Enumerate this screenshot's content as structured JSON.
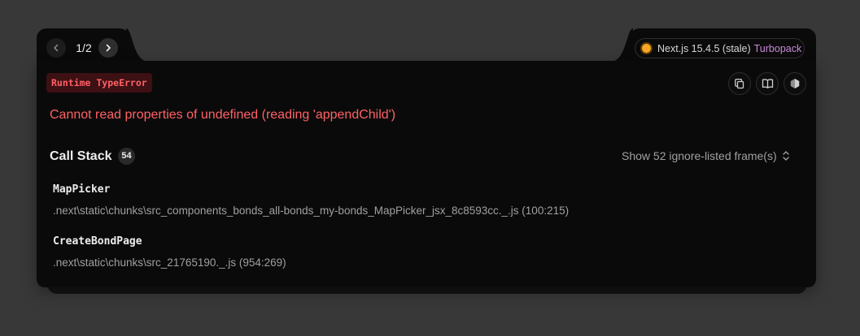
{
  "pager": {
    "current_label": "1/2",
    "prev_icon": "chevron-left-icon",
    "next_icon": "chevron-right-icon"
  },
  "version": {
    "label": "Next.js 15.4.5 (stale)",
    "bundler": "Turbopack",
    "status_color": "#f5a623"
  },
  "error": {
    "type": "Runtime TypeError",
    "message": "Cannot read properties of undefined (reading 'appendChild')"
  },
  "toolbar": {
    "icons": [
      "copy-icon",
      "docs-book-icon",
      "nextjs-logo-icon"
    ]
  },
  "callstack": {
    "title": "Call Stack",
    "count": "54",
    "ignore_toggle_label": "Show 52 ignore-listed frame(s)",
    "frames": [
      {
        "name": "MapPicker",
        "path": ".next\\static\\chunks\\src_components_bonds_all-bonds_my-bonds_MapPicker_jsx_8c8593cc._.js (100:215)"
      },
      {
        "name": "CreateBondPage",
        "path": ".next\\static\\chunks\\src_21765190._.js (954:269)"
      }
    ]
  },
  "colors": {
    "error_red": "#ff6166",
    "panel_bg": "#0a0a0a",
    "backdrop": "#383838",
    "bundler_accent": "#c98bd8"
  }
}
